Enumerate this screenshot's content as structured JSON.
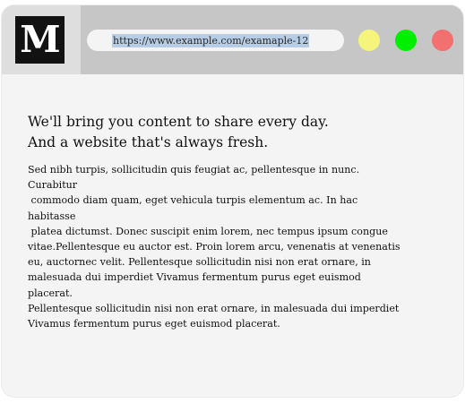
{
  "window": {
    "logo_letter": "M",
    "address_bar": {
      "url": "https://www.example.com/examaple-12"
    },
    "controls": [
      {
        "name": "minimize",
        "color": "#f6f57b"
      },
      {
        "name": "maximize",
        "color": "#00f000"
      },
      {
        "name": "close",
        "color": "#f2706f"
      }
    ]
  },
  "content": {
    "headline_lines": [
      "We'll bring you content to share every day.",
      "And a website that's always fresh."
    ],
    "body_lines": [
      "Sed nibh turpis, sollicitudin quis feugiat ac, pellentesque in nunc.",
      "Curabitur",
      " commodo diam quam, eget vehicula turpis elementum ac. In hac",
      "habitasse",
      " platea dictumst. Donec suscipit enim lorem, nec tempus ipsum congue",
      "vitae.Pellentesque eu auctor est. Proin lorem arcu, venenatis at venenatis",
      "eu, auctornec velit. Pellentesque sollicitudin nisi non erat ornare, in",
      "malesuada dui imperdiet Vivamus fermentum purus eget euismod",
      "placerat.",
      "Pellentesque sollicitudin nisi non erat ornare, in malesuada dui imperdiet",
      "Vivamus fermentum purus eget euismod placerat."
    ]
  }
}
